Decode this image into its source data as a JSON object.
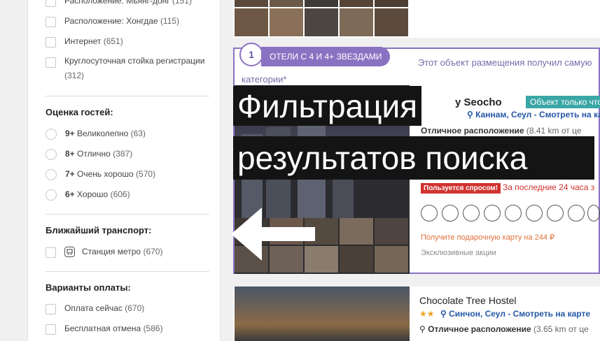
{
  "sidebar": {
    "location_options": [
      {
        "label": "Расположение: Мьянг-донг",
        "count": "(151)"
      },
      {
        "label": "Расположение: Хонгдае",
        "count": "(115)"
      },
      {
        "label": "Интернет",
        "count": "(651)"
      },
      {
        "label": "Круглосуточная стойка регистрации",
        "count": "(312)"
      }
    ],
    "guest_rating": {
      "title": "Оценка гостей:",
      "options": [
        {
          "score": "9+",
          "label": "Великолепно",
          "count": "(63)"
        },
        {
          "score": "8+",
          "label": "Отлично",
          "count": "(387)"
        },
        {
          "score": "7+",
          "label": "Очень хорошо",
          "count": "(570)"
        },
        {
          "score": "6+",
          "label": "Хорошо",
          "count": "(606)"
        }
      ]
    },
    "transport": {
      "title": "Ближайший транспорт:",
      "options": [
        {
          "label": "Станция метро",
          "count": "(670)"
        }
      ]
    },
    "payment": {
      "title": "Варианты оплаты:",
      "options": [
        {
          "label": "Оплата сейчас",
          "count": "(670)"
        },
        {
          "label": "Бесплатная отмена",
          "count": "(586)"
        }
      ]
    }
  },
  "results": {
    "featured": {
      "rank": "1",
      "stars_badge": "ОТЕЛИ С 4 И 4+ ЗВЕЗДАМИ",
      "category_note": "Этот объект размещения получил самую",
      "category_note2": "категории*",
      "name_partial": "y Seocho",
      "app_only": "Объект только что",
      "location": "Каннам, Сеул - Смотреть на ка",
      "location_tag": "Отличное расположение",
      "distance": "(8.41 km от це",
      "demand": "Пользуется спросом!",
      "recent": "За последние 24 часа з",
      "gift": "Получите подарочную карту на 244 ₽",
      "exclusive": "Эксклюзивные акции"
    },
    "second": {
      "name": "Chocolate Tree Hostel",
      "location": "Синчон, Сеул - Смотреть на карте",
      "location_tag": "Отличное расположение",
      "distance": "(3.65 km от це"
    }
  },
  "overlay": {
    "line1": "Фильтрация",
    "line2": "результатов поиска"
  },
  "colors": {
    "accent_purple": "#8a72c2",
    "link_blue": "#2457a6",
    "demand_red": "#d0332f",
    "gift_orange": "#e0703a",
    "app_badge_teal": "#3aa6a6"
  },
  "icons": [
    "transit-icon",
    "arrow-left-icon",
    "pin-icon",
    "star-icon"
  ]
}
